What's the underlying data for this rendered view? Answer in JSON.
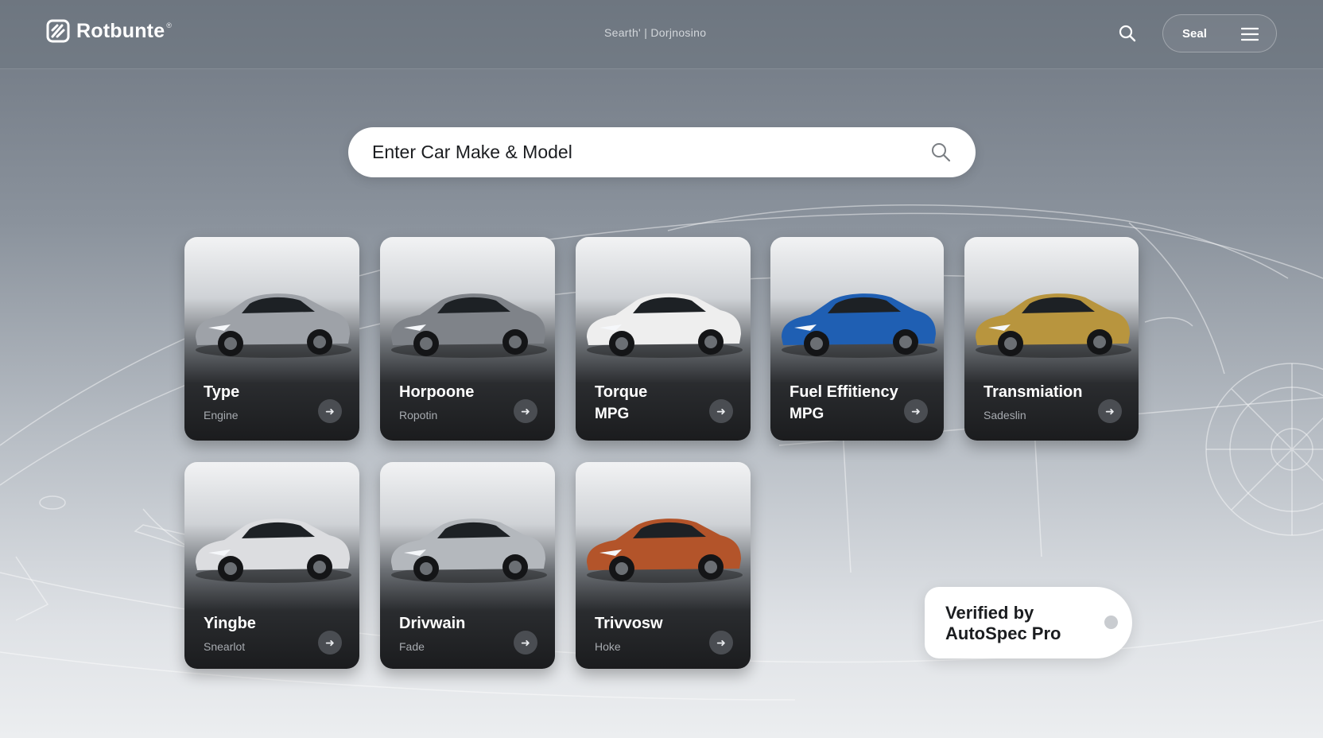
{
  "brand": {
    "name": "Rotbunte",
    "reg_mark": "®",
    "logo_icon": "brand-logo-icon"
  },
  "nav": {
    "center_left": "Searth'",
    "center_right": "Dorjnosino"
  },
  "header": {
    "search_icon": "search-icon",
    "pill_label": "Seal",
    "menu_icon": "menu-icon"
  },
  "search": {
    "placeholder": "Enter Car Make & Model",
    "icon": "search-icon"
  },
  "cards": [
    {
      "title": "Type",
      "subtitle": "Engine",
      "car_color": "#9ea2a8"
    },
    {
      "title": "Horpoone",
      "subtitle": "Ropotin",
      "car_color": "#7f8389"
    },
    {
      "title": "Torque",
      "subtitle": "MPG",
      "car_color": "#eeeeee"
    },
    {
      "title": "Fuel Effitiency",
      "subtitle": "MPG",
      "car_color": "#1f5fb3"
    },
    {
      "title": "Transmiation",
      "subtitle": "Sadeslin",
      "car_color": "#b8953e"
    },
    {
      "title": "Yingbe",
      "subtitle": "Snearlot",
      "car_color": "#dcdde0"
    },
    {
      "title": "Drivwain",
      "subtitle": "Fade",
      "car_color": "#b4b8bd"
    },
    {
      "title": "Trivvosw",
      "subtitle": "Hoke",
      "car_color": "#b3542a"
    }
  ],
  "card_arrow_icon": "arrow-right-icon",
  "verified": {
    "line1": "Verified by",
    "line2": "AutoSpec Pro"
  },
  "colors": {
    "accent": "#ffffff",
    "card_dark": "#1b1c1e",
    "header_bg": "#6e7680"
  }
}
